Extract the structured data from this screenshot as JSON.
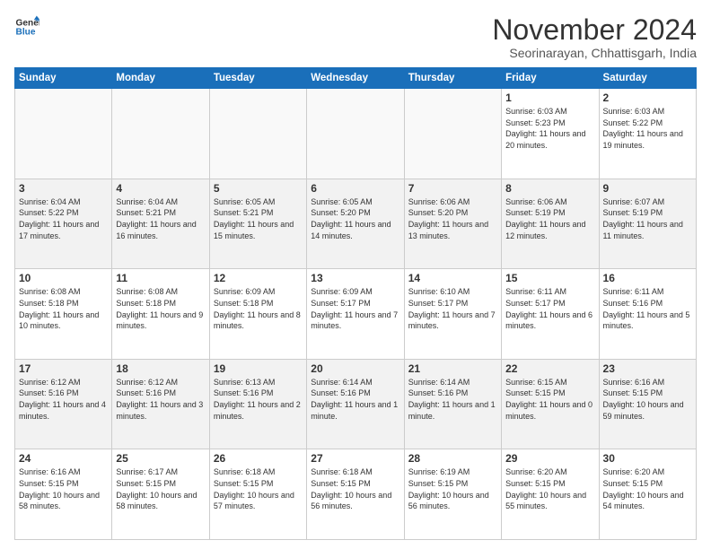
{
  "logo": {
    "line1": "General",
    "line2": "Blue"
  },
  "title": "November 2024",
  "subtitle": "Seorinarayan, Chhattisgarh, India",
  "weekdays": [
    "Sunday",
    "Monday",
    "Tuesday",
    "Wednesday",
    "Thursday",
    "Friday",
    "Saturday"
  ],
  "weeks": [
    [
      {
        "day": "",
        "info": ""
      },
      {
        "day": "",
        "info": ""
      },
      {
        "day": "",
        "info": ""
      },
      {
        "day": "",
        "info": ""
      },
      {
        "day": "",
        "info": ""
      },
      {
        "day": "1",
        "info": "Sunrise: 6:03 AM\nSunset: 5:23 PM\nDaylight: 11 hours and 20 minutes."
      },
      {
        "day": "2",
        "info": "Sunrise: 6:03 AM\nSunset: 5:22 PM\nDaylight: 11 hours and 19 minutes."
      }
    ],
    [
      {
        "day": "3",
        "info": "Sunrise: 6:04 AM\nSunset: 5:22 PM\nDaylight: 11 hours and 17 minutes."
      },
      {
        "day": "4",
        "info": "Sunrise: 6:04 AM\nSunset: 5:21 PM\nDaylight: 11 hours and 16 minutes."
      },
      {
        "day": "5",
        "info": "Sunrise: 6:05 AM\nSunset: 5:21 PM\nDaylight: 11 hours and 15 minutes."
      },
      {
        "day": "6",
        "info": "Sunrise: 6:05 AM\nSunset: 5:20 PM\nDaylight: 11 hours and 14 minutes."
      },
      {
        "day": "7",
        "info": "Sunrise: 6:06 AM\nSunset: 5:20 PM\nDaylight: 11 hours and 13 minutes."
      },
      {
        "day": "8",
        "info": "Sunrise: 6:06 AM\nSunset: 5:19 PM\nDaylight: 11 hours and 12 minutes."
      },
      {
        "day": "9",
        "info": "Sunrise: 6:07 AM\nSunset: 5:19 PM\nDaylight: 11 hours and 11 minutes."
      }
    ],
    [
      {
        "day": "10",
        "info": "Sunrise: 6:08 AM\nSunset: 5:18 PM\nDaylight: 11 hours and 10 minutes."
      },
      {
        "day": "11",
        "info": "Sunrise: 6:08 AM\nSunset: 5:18 PM\nDaylight: 11 hours and 9 minutes."
      },
      {
        "day": "12",
        "info": "Sunrise: 6:09 AM\nSunset: 5:18 PM\nDaylight: 11 hours and 8 minutes."
      },
      {
        "day": "13",
        "info": "Sunrise: 6:09 AM\nSunset: 5:17 PM\nDaylight: 11 hours and 7 minutes."
      },
      {
        "day": "14",
        "info": "Sunrise: 6:10 AM\nSunset: 5:17 PM\nDaylight: 11 hours and 7 minutes."
      },
      {
        "day": "15",
        "info": "Sunrise: 6:11 AM\nSunset: 5:17 PM\nDaylight: 11 hours and 6 minutes."
      },
      {
        "day": "16",
        "info": "Sunrise: 6:11 AM\nSunset: 5:16 PM\nDaylight: 11 hours and 5 minutes."
      }
    ],
    [
      {
        "day": "17",
        "info": "Sunrise: 6:12 AM\nSunset: 5:16 PM\nDaylight: 11 hours and 4 minutes."
      },
      {
        "day": "18",
        "info": "Sunrise: 6:12 AM\nSunset: 5:16 PM\nDaylight: 11 hours and 3 minutes."
      },
      {
        "day": "19",
        "info": "Sunrise: 6:13 AM\nSunset: 5:16 PM\nDaylight: 11 hours and 2 minutes."
      },
      {
        "day": "20",
        "info": "Sunrise: 6:14 AM\nSunset: 5:16 PM\nDaylight: 11 hours and 1 minute."
      },
      {
        "day": "21",
        "info": "Sunrise: 6:14 AM\nSunset: 5:16 PM\nDaylight: 11 hours and 1 minute."
      },
      {
        "day": "22",
        "info": "Sunrise: 6:15 AM\nSunset: 5:15 PM\nDaylight: 11 hours and 0 minutes."
      },
      {
        "day": "23",
        "info": "Sunrise: 6:16 AM\nSunset: 5:15 PM\nDaylight: 10 hours and 59 minutes."
      }
    ],
    [
      {
        "day": "24",
        "info": "Sunrise: 6:16 AM\nSunset: 5:15 PM\nDaylight: 10 hours and 58 minutes."
      },
      {
        "day": "25",
        "info": "Sunrise: 6:17 AM\nSunset: 5:15 PM\nDaylight: 10 hours and 58 minutes."
      },
      {
        "day": "26",
        "info": "Sunrise: 6:18 AM\nSunset: 5:15 PM\nDaylight: 10 hours and 57 minutes."
      },
      {
        "day": "27",
        "info": "Sunrise: 6:18 AM\nSunset: 5:15 PM\nDaylight: 10 hours and 56 minutes."
      },
      {
        "day": "28",
        "info": "Sunrise: 6:19 AM\nSunset: 5:15 PM\nDaylight: 10 hours and 56 minutes."
      },
      {
        "day": "29",
        "info": "Sunrise: 6:20 AM\nSunset: 5:15 PM\nDaylight: 10 hours and 55 minutes."
      },
      {
        "day": "30",
        "info": "Sunrise: 6:20 AM\nSunset: 5:15 PM\nDaylight: 10 hours and 54 minutes."
      }
    ]
  ],
  "colors": {
    "header_bg": "#1a6fba",
    "accent": "#1a6fba"
  }
}
